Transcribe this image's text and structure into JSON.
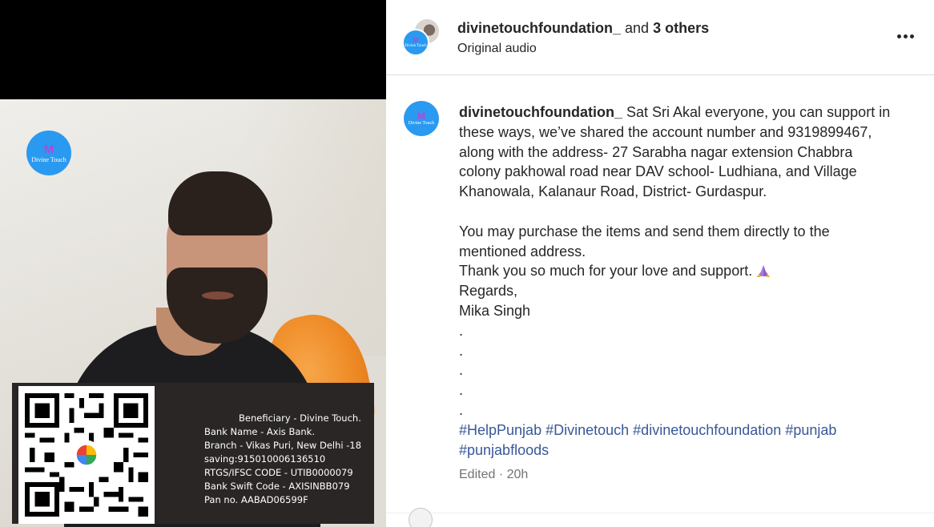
{
  "media": {
    "logo": {
      "mark": "M",
      "text": "Divine Touch"
    },
    "bank_card": {
      "lines": [
        "Beneficiary  - Divine Touch.",
        "Bank Name - Axis Bank.",
        "Branch - Vikas Puri, New Delhi -18",
        "saving:915010006136510",
        "RTGS/IFSC CODE - UTIB0000079",
        "Bank Swift Code - AXISINBB079",
        "Pan no. AABAD06599F"
      ]
    }
  },
  "header": {
    "username": "divinetouchfoundation_",
    "and_text": "and",
    "others": "3 others",
    "audio": "Original audio",
    "more_icon": "ellipsis-icon",
    "avatar_mark": "M",
    "avatar_text": "Divine Touch"
  },
  "caption": {
    "avatar_mark": "M",
    "avatar_text": "Divine Touch",
    "username": "divinetouchfoundation_",
    "lines": [
      "Sat Sri Akal everyone, you can support in",
      "these ways, we’ve shared the account number and 9319899467,",
      "along with the address- 27 Sarabha nagar extension Chabbra",
      "colony pakhowal road near DAV school- Ludhiana, and Village",
      "Khanowala, Kalanaur Road, District- Gurdaspur.",
      "",
      "You may purchase the items and send them directly to the",
      "mentioned address.",
      "Thank you so much for your love and support.",
      "Regards,",
      "Mika Singh",
      ".",
      ".",
      ".",
      ".",
      "."
    ],
    "hashtags_line1": [
      "#HelpPunjab",
      "#Divinetouch",
      "#divinetouchfoundation",
      "#punjab"
    ],
    "hashtags_line2": [
      "#punjabfloods"
    ],
    "emoji_icon": "folded-hands-icon"
  },
  "meta": {
    "edited": "Edited",
    "sep": "·",
    "time": "20h"
  },
  "colors": {
    "hashtag": "#385898",
    "muted": "#737373",
    "logo_blue": "#2a9af0"
  }
}
